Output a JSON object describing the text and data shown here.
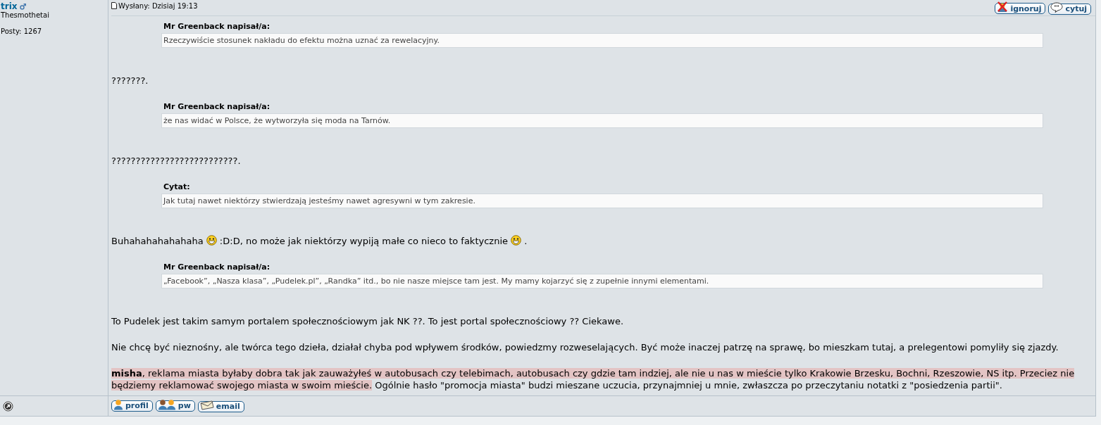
{
  "author": {
    "name": "trix",
    "rank": "Thesmothetai",
    "posts": "Posty: 1267"
  },
  "post": {
    "date": "Wysłany: Dzisiaj 19:13",
    "actions": [
      {
        "kind": "ignore",
        "label": "ignoruj"
      },
      {
        "kind": "quote",
        "label": "cytuj"
      }
    ],
    "blocks": [
      {
        "kind": "quote",
        "author": "Mr Greenback napisał/a:",
        "text": "Rzeczywiście stosunek nakładu do efektu można uznać za rewelacyjny."
      },
      {
        "kind": "text",
        "segments": [
          {
            "kind": "plain",
            "text": "???????."
          }
        ]
      },
      {
        "kind": "quote",
        "author": "Mr Greenback napisał/a:",
        "text": "że nas widać w Polsce, że wytworzyła się moda na Tarnów."
      },
      {
        "kind": "text",
        "segments": [
          {
            "kind": "plain",
            "text": "??????????????????????????."
          }
        ]
      },
      {
        "kind": "quote",
        "author": "Cytat:",
        "text": "Jak tutaj nawet niektórzy stwierdzają jesteśmy nawet agresywni w tym zakresie."
      },
      {
        "kind": "text",
        "segments": [
          {
            "kind": "plain",
            "text": "Buhahahahahahaha "
          },
          {
            "kind": "smiley"
          },
          {
            "kind": "plain",
            "text": " :D:D, no może jak niektórzy wypiją małe co nieco to faktycznie "
          },
          {
            "kind": "smiley"
          },
          {
            "kind": "plain",
            "text": " ."
          }
        ]
      },
      {
        "kind": "quote",
        "author": "Mr Greenback napisał/a:",
        "text": "„Facebook”, „Nasza klasa”, „Pudelek.pl”, „Randka” itd., bo nie nasze miejsce tam jest. My mamy kojarzyć się z zupełnie innymi elementami."
      },
      {
        "kind": "text",
        "segments": [
          {
            "kind": "plain",
            "text": "To Pudelek jest takim samym portalem społecznościowym jak NK ??. To jest portal społecznościowy ?? Ciekawe."
          }
        ]
      },
      {
        "kind": "text",
        "segments": [
          {
            "kind": "plain",
            "text": "Nie chcę być nieznośny, ale twórca tego dzieła, działał chyba pod wpływem środków, powiedzmy rozweselających. Być może inaczej patrzę na sprawę, bo mieszkam tutaj, a prelegentowi pomyliły się zjazdy."
          }
        ]
      },
      {
        "kind": "text",
        "segments": [
          {
            "kind": "highlight",
            "text": "**misha**, reklama miasta byłaby dobra tak jak zauważyłeś w autobusach czy telebimach, autobusach czy gdzie tam indziej, ale nie u nas w mieście tylko Krakowie Brzesku, Bochni, Rzeszowie, NS itp. Przeciez nie będziemy reklamować swojego miasta w swoim mieście."
          },
          {
            "kind": "plain",
            "text": " Ogólnie hasło \"promocja miasta\" budzi mieszane uczucia, przynajmniej u mnie, zwłaszcza po przeczytaniu notatki z \"posiedzenia partii\"."
          }
        ]
      }
    ]
  },
  "footer": {
    "buttons": [
      {
        "kind": "profile",
        "label": "profil"
      },
      {
        "kind": "pm",
        "label": "pw"
      },
      {
        "kind": "email",
        "label": "email"
      }
    ]
  }
}
